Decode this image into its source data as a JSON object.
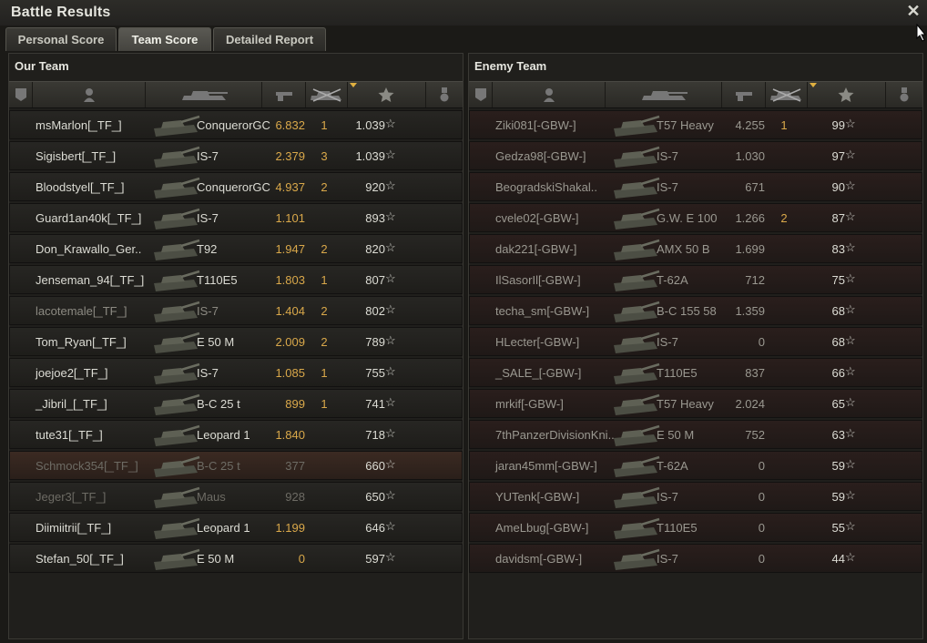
{
  "window": {
    "title": "Battle Results"
  },
  "tabs": [
    "Personal Score",
    "Team Score",
    "Detailed Report"
  ],
  "our_team": {
    "title": "Our Team",
    "rows": [
      {
        "name": "msMarlon[_TF_]",
        "vehicle": "ConquerorGC",
        "damage": "6.832",
        "kills": "1",
        "xp": "1.039"
      },
      {
        "name": "Sigisbert[_TF_]",
        "vehicle": "IS-7",
        "damage": "2.379",
        "kills": "3",
        "xp": "1.039"
      },
      {
        "name": "Bloodstyel[_TF_]",
        "vehicle": "ConquerorGC",
        "damage": "4.937",
        "kills": "2",
        "xp": "920"
      },
      {
        "name": "Guard1an40k[_TF_]",
        "vehicle": "IS-7",
        "damage": "1.101",
        "kills": "",
        "xp": "893"
      },
      {
        "name": "Don_Krawallo_Ger..",
        "vehicle": "T92",
        "damage": "1.947",
        "kills": "2",
        "xp": "820"
      },
      {
        "name": "Jenseman_94[_TF_]",
        "vehicle": "T110E5",
        "damage": "1.803",
        "kills": "1",
        "xp": "807"
      },
      {
        "name": "lacotemale[_TF_]",
        "vehicle": "IS-7",
        "damage": "1.404",
        "kills": "2",
        "xp": "802"
      },
      {
        "name": "Tom_Ryan[_TF_]",
        "vehicle": "E 50 M",
        "damage": "2.009",
        "kills": "2",
        "xp": "789"
      },
      {
        "name": "joejoe2[_TF_]",
        "vehicle": "IS-7",
        "damage": "1.085",
        "kills": "1",
        "xp": "755"
      },
      {
        "name": "_Jibril_[_TF_]",
        "vehicle": "B-C 25 t",
        "damage": "899",
        "kills": "1",
        "xp": "741"
      },
      {
        "name": "tute31[_TF_]",
        "vehicle": "Leopard 1",
        "damage": "1.840",
        "kills": "",
        "xp": "718"
      },
      {
        "name": "Schmock354[_TF_]",
        "vehicle": "B-C 25 t",
        "damage": "377",
        "kills": "",
        "xp": "660"
      },
      {
        "name": "Jeger3[_TF_]",
        "vehicle": "Maus",
        "damage": "928",
        "kills": "",
        "xp": "650"
      },
      {
        "name": "Diimiitrii[_TF_]",
        "vehicle": "Leopard 1",
        "damage": "1.199",
        "kills": "",
        "xp": "646"
      },
      {
        "name": "Stefan_50[_TF_]",
        "vehicle": "E 50 M",
        "damage": "0",
        "kills": "",
        "xp": "597"
      }
    ]
  },
  "enemy_team": {
    "title": "Enemy Team",
    "rows": [
      {
        "name": "Ziki081[-GBW-]",
        "vehicle": "T57 Heavy",
        "damage": "4.255",
        "kills": "1",
        "xp": "99"
      },
      {
        "name": "Gedza98[-GBW-]",
        "vehicle": "IS-7",
        "damage": "1.030",
        "kills": "",
        "xp": "97"
      },
      {
        "name": "BeogradskiShakal..",
        "vehicle": "IS-7",
        "damage": "671",
        "kills": "",
        "xp": "90"
      },
      {
        "name": "cvele02[-GBW-]",
        "vehicle": "G.W. E 100",
        "damage": "1.266",
        "kills": "2",
        "xp": "87"
      },
      {
        "name": "dak221[-GBW-]",
        "vehicle": "AMX 50 B",
        "damage": "1.699",
        "kills": "",
        "xp": "83"
      },
      {
        "name": "IlSasorIl[-GBW-]",
        "vehicle": "T-62A",
        "damage": "712",
        "kills": "",
        "xp": "75"
      },
      {
        "name": "techa_sm[-GBW-]",
        "vehicle": "B-C 155 58",
        "damage": "1.359",
        "kills": "",
        "xp": "68"
      },
      {
        "name": "HLecter[-GBW-]",
        "vehicle": "IS-7",
        "damage": "0",
        "kills": "",
        "xp": "68"
      },
      {
        "name": "_SALE_[-GBW-]",
        "vehicle": "T110E5",
        "damage": "837",
        "kills": "",
        "xp": "66"
      },
      {
        "name": "mrkif[-GBW-]",
        "vehicle": "T57 Heavy",
        "damage": "2.024",
        "kills": "",
        "xp": "65"
      },
      {
        "name": "7thPanzerDivisionKni..",
        "vehicle": "E 50 M",
        "damage": "752",
        "kills": "",
        "xp": "63"
      },
      {
        "name": "jaran45mm[-GBW-]",
        "vehicle": "T-62A",
        "damage": "0",
        "kills": "",
        "xp": "59"
      },
      {
        "name": "YUTenk[-GBW-]",
        "vehicle": "IS-7",
        "damage": "0",
        "kills": "",
        "xp": "59"
      },
      {
        "name": "AmeLbug[-GBW-]",
        "vehicle": "T110E5",
        "damage": "0",
        "kills": "",
        "xp": "55"
      },
      {
        "name": "davidsm[-GBW-]",
        "vehicle": "IS-7",
        "damage": "0",
        "kills": "",
        "xp": "44"
      }
    ]
  },
  "icons": {
    "platoon": "platoon-icon",
    "player": "player-icon",
    "vehicle": "tank-icon",
    "damage": "gun-icon",
    "kills": "destroyed-tank-icon",
    "xp": "star-icon",
    "medal": "medal-icon"
  }
}
